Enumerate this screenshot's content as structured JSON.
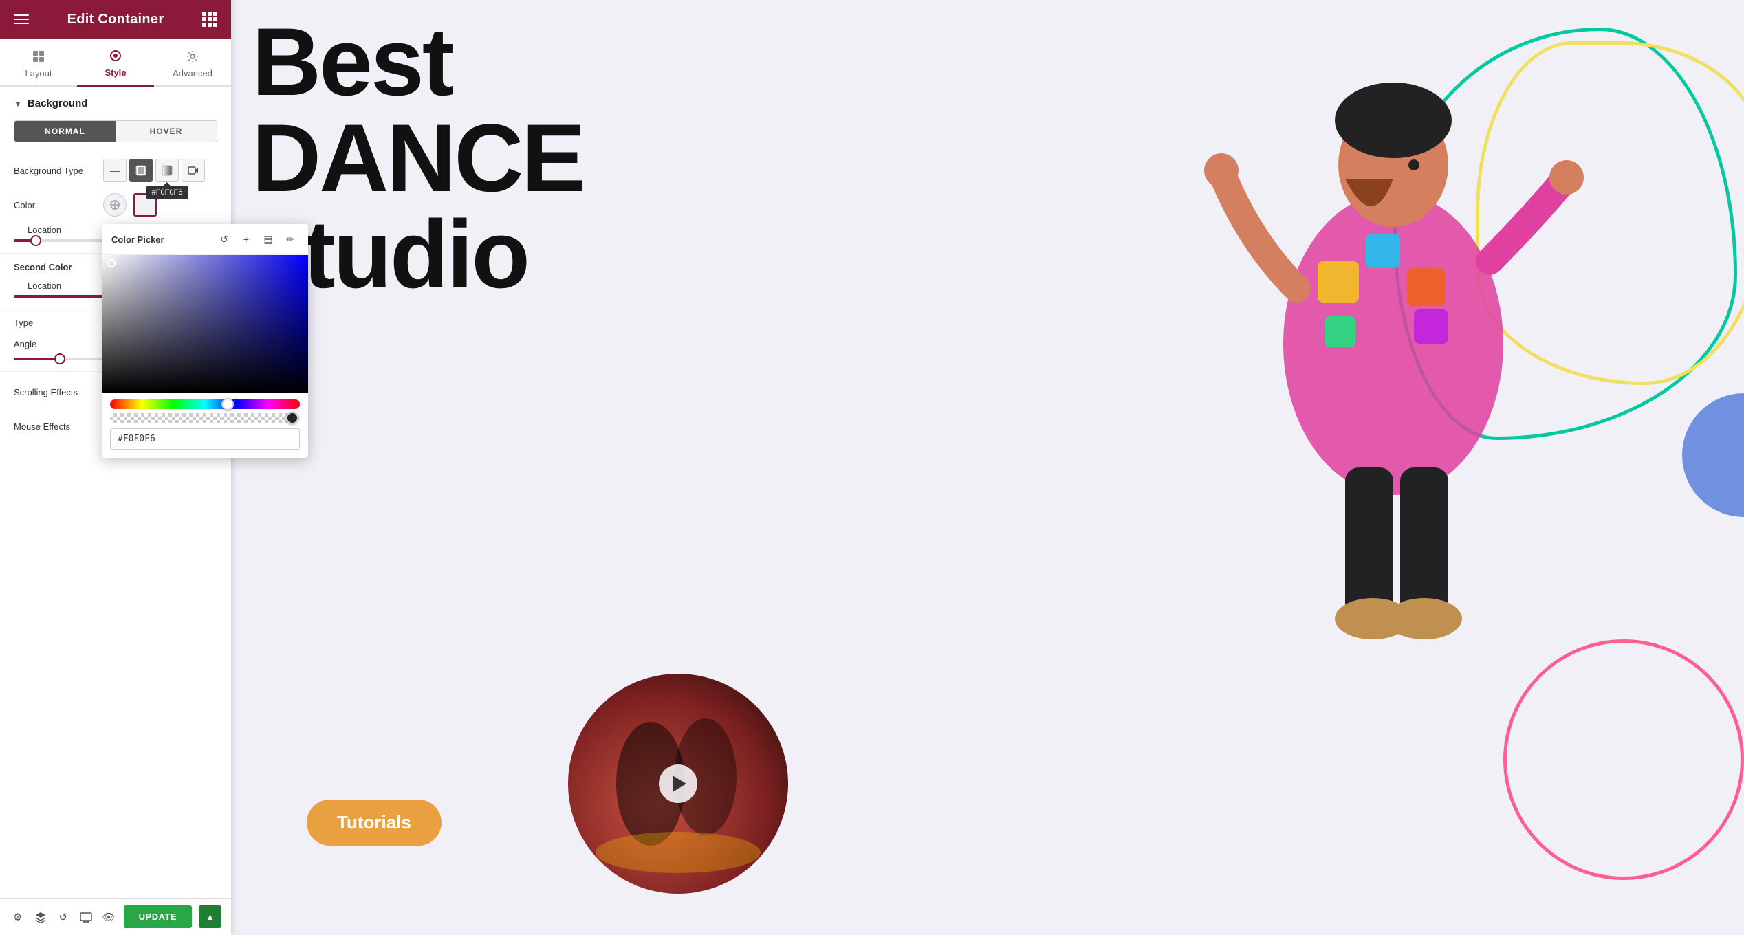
{
  "panel": {
    "title": "Edit Container",
    "tabs": [
      {
        "id": "layout",
        "label": "Layout",
        "icon": "layout-icon"
      },
      {
        "id": "style",
        "label": "Style",
        "icon": "style-icon"
      },
      {
        "id": "advanced",
        "label": "Advanced",
        "icon": "advanced-icon"
      }
    ],
    "active_tab": "style",
    "section": {
      "label": "Background"
    },
    "normal_hover": {
      "tabs": [
        "NORMAL",
        "HOVER"
      ],
      "active": "NORMAL"
    },
    "background_type": {
      "label": "Background Type",
      "tooltip": "#F0F0F6",
      "options": [
        "none",
        "classic",
        "gradient",
        "video"
      ]
    },
    "color": {
      "label": "Color"
    },
    "location": {
      "label": "Location"
    },
    "second_color": {
      "label": "Second Color"
    },
    "location2": {
      "label": "Location"
    },
    "type": {
      "label": "Type"
    },
    "angle": {
      "label": "Angle"
    },
    "scrolling_effects": {
      "label": "Scrolling Effects",
      "toggle": "OFF"
    },
    "mouse_effects": {
      "label": "Mouse Effects",
      "toggle": "OFF"
    },
    "bottom_bar": {
      "update_label": "UPDATE"
    }
  },
  "color_picker": {
    "title": "Color Picker",
    "hex_value": "#F0F0F6",
    "actions": {
      "reset": "↺",
      "add": "+",
      "swatches": "▤",
      "eyedropper": "✏"
    }
  },
  "canvas": {
    "hero_line1": "Best",
    "hero_line2": "DANCE",
    "hero_line3": "studio",
    "tutorials_button": "Tutorials"
  }
}
